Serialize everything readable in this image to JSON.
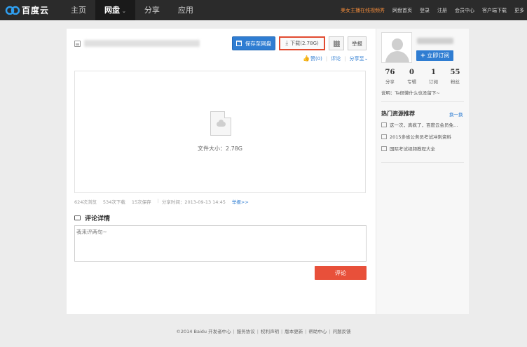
{
  "brand": {
    "name": "百度云"
  },
  "nav": {
    "items": [
      {
        "label": "主页"
      },
      {
        "label": "网盘",
        "caret": "⌄"
      },
      {
        "label": "分享"
      },
      {
        "label": "应用"
      }
    ]
  },
  "toplinks": {
    "promo": "美女主播在线视频秀",
    "items": [
      "网盘首页",
      "登录",
      "注册",
      "会员中心",
      "客户端下载",
      "更多"
    ]
  },
  "toolbar": {
    "save_label": "保存至网盘",
    "download_label": "下载(2.78G)",
    "report_label": "举报"
  },
  "actions": {
    "like": "赞(0)",
    "comment": "评论",
    "share": "分享至"
  },
  "preview": {
    "filesize_text": "文件大小：2.78G"
  },
  "stats": {
    "views": "624次浏览",
    "downloads": "534次下载",
    "saves": "15次保存",
    "share_time": "分享时间：2013-09-13 14:45",
    "report_link": "举报>>"
  },
  "comments": {
    "title": "评论详情",
    "placeholder": "我来评两句~",
    "submit_label": "评论"
  },
  "profile": {
    "subscribe_label": "立即订阅",
    "counts": [
      {
        "num": "76",
        "label": "分享"
      },
      {
        "num": "0",
        "label": "专辑"
      },
      {
        "num": "1",
        "label": "订阅"
      },
      {
        "num": "55",
        "label": "粉丝"
      }
    ],
    "intro": "说明：Ta很懒什么也没留下~"
  },
  "hot": {
    "title": "热门资源推荐",
    "refresh": "换一换",
    "items": [
      "这一次，真疯了，百度云会员免…",
      "2015多省公务员考试冲刺资料",
      "国际考试视频教程大全"
    ]
  },
  "footer": {
    "copyright": "©2014 Baidu",
    "links": [
      "开发者中心",
      "服务协议",
      "权利声明",
      "版本更新",
      "帮助中心",
      "问题反馈"
    ]
  },
  "colors": {
    "accent": "#2f7dd2",
    "download_border": "#e24a2f",
    "comment_button": "#e8503a",
    "topbar": "#2b2b2b"
  }
}
